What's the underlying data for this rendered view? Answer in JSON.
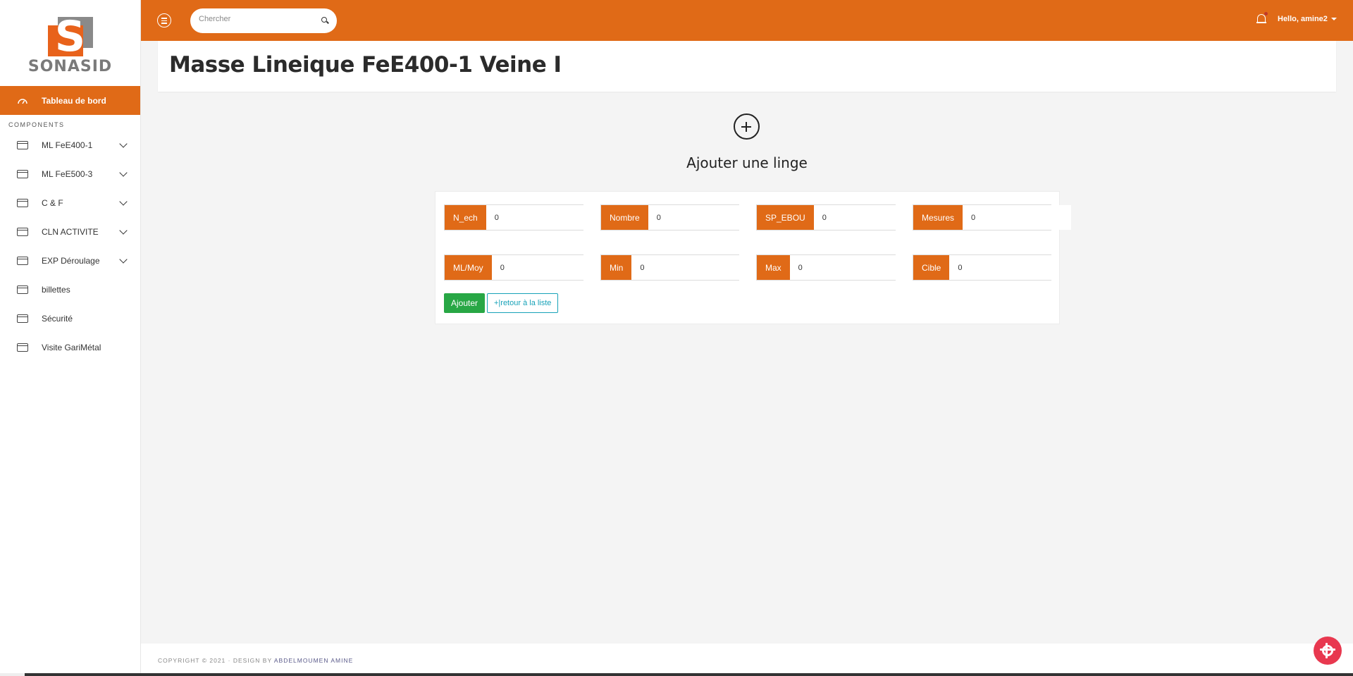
{
  "brand": {
    "name": "SONASID",
    "logo_letter": "S"
  },
  "sidebar": {
    "active_item": {
      "label": "Tableau de bord",
      "icon": "dashboard-gauge-icon"
    },
    "section_title": "COMPONENTS",
    "items": [
      {
        "label": "ML FeE400-1",
        "has_children": true
      },
      {
        "label": "ML FeE500-3",
        "has_children": true
      },
      {
        "label": "C & F",
        "has_children": true
      },
      {
        "label": "CLN ACTIVITE",
        "has_children": true
      },
      {
        "label": "EXP Déroulage",
        "has_children": true
      },
      {
        "label": "billettes",
        "has_children": false
      },
      {
        "label": "Sécurité",
        "has_children": false
      },
      {
        "label": "Visite GariMétal",
        "has_children": false
      }
    ]
  },
  "topbar": {
    "search_placeholder": "Chercher",
    "user_greeting": "Hello, amine2"
  },
  "page": {
    "title": "Masse Lineique FeE400-1 Veine I",
    "add_title": "Ajouter une linge"
  },
  "form": {
    "fields": [
      {
        "label": "N_ech",
        "value": "0"
      },
      {
        "label": "Nombre",
        "value": "0"
      },
      {
        "label": "SP_EBOU",
        "value": "0"
      },
      {
        "label": "Mesures",
        "value": "0"
      },
      {
        "label": "ML/Moy",
        "value": "0"
      },
      {
        "label": "Min",
        "value": "0"
      },
      {
        "label": "Max",
        "value": "0"
      },
      {
        "label": "Cible",
        "value": "0"
      }
    ],
    "submit_label": "Ajouter",
    "back_label": "+|retour à la liste"
  },
  "footer": {
    "copyright": "COPYRIGHT © 2021  ·  DESIGN BY",
    "author": "ABDELMOUMEN AMINE"
  },
  "colors": {
    "accent": "#e06a17",
    "success": "#28a745",
    "info": "#17a2b8",
    "settings": "#e8384f"
  }
}
